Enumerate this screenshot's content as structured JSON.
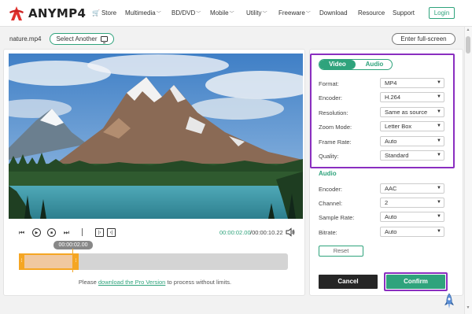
{
  "brand": {
    "name": "ANYMP4"
  },
  "nav": {
    "items": [
      {
        "label": "Store"
      },
      {
        "label": "Multimedia"
      },
      {
        "label": "BD/DVD"
      },
      {
        "label": "Mobile"
      },
      {
        "label": "Utility"
      },
      {
        "label": "Freeware"
      },
      {
        "label": "Download"
      },
      {
        "label": "Resource"
      },
      {
        "label": "Support"
      }
    ],
    "login": "Login"
  },
  "file": {
    "name": "nature.mp4",
    "select_another": "Select Another",
    "fullscreen": "Enter full-screen"
  },
  "player": {
    "current_time": "00:00:02.00",
    "total_time": "/00:00:10.22",
    "bubble_time": "00:00:02.00",
    "selection_fraction": 0.19
  },
  "notice": {
    "before": "Please ",
    "link": "download the Pro Version",
    "after": " to process without limits."
  },
  "tabs": {
    "video": "Video",
    "audio": "Audio"
  },
  "video_settings": [
    {
      "label": "Format:",
      "value": "MP4"
    },
    {
      "label": "Encoder:",
      "value": "H.264"
    },
    {
      "label": "Resolution:",
      "value": "Same as source"
    },
    {
      "label": "Zoom Mode:",
      "value": "Letter Box"
    },
    {
      "label": "Frame Rate:",
      "value": "Auto"
    },
    {
      "label": "Quality:",
      "value": "Standard"
    }
  ],
  "audio_heading": "Audio",
  "audio_settings": [
    {
      "label": "Encoder:",
      "value": "AAC"
    },
    {
      "label": "Channel:",
      "value": "2"
    },
    {
      "label": "Sample Rate:",
      "value": "Auto"
    },
    {
      "label": "Bitrate:",
      "value": "Auto"
    }
  ],
  "buttons": {
    "reset": "Reset",
    "cancel": "Cancel",
    "confirm": "Confirm"
  },
  "colors": {
    "accent": "#2fa37c",
    "highlight": "#8a2ec0",
    "trim": "#f5a623",
    "brand_red": "#e0312c"
  }
}
